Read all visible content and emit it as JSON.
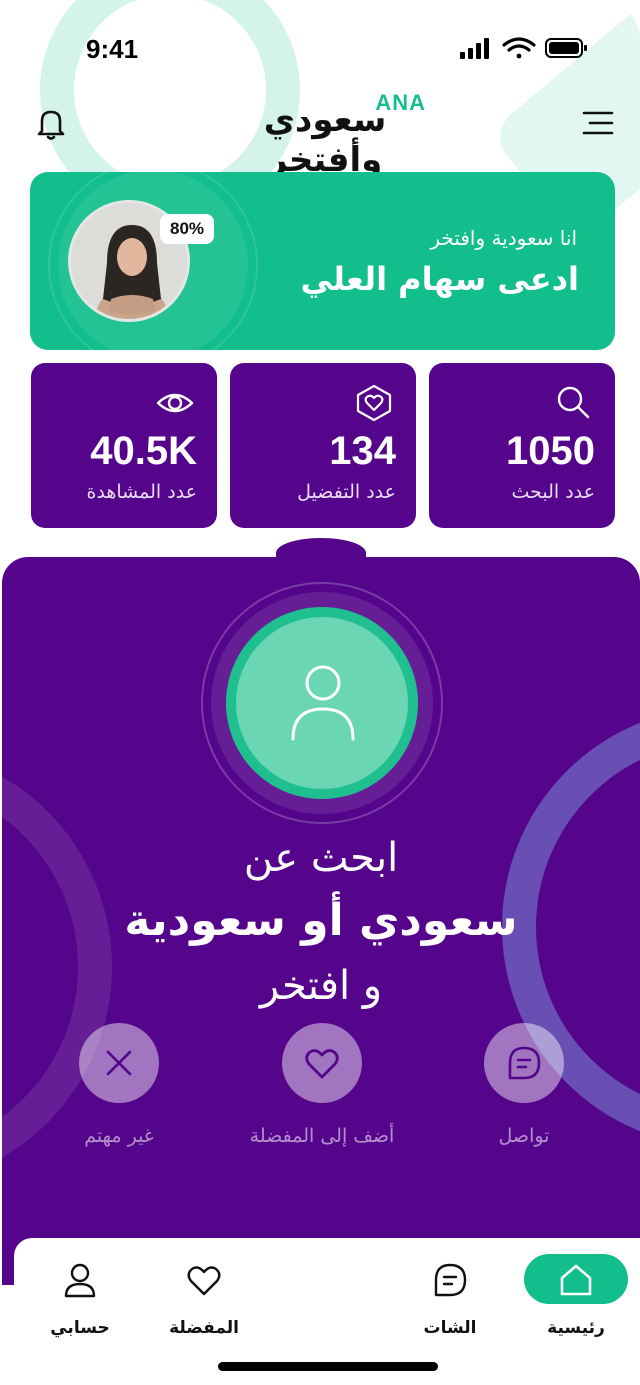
{
  "status_bar": {
    "time": "9:41"
  },
  "header": {
    "logo_ana": "ANA",
    "logo_arabic": "سعودي وأفتخر"
  },
  "profile": {
    "completion": "80%",
    "subtitle": "انا سعودية وافتخر",
    "name": "ادعى سهام العلي"
  },
  "stats": [
    {
      "value": "1050",
      "label": "عدد البحث",
      "icon": "search-icon"
    },
    {
      "value": "134",
      "label": "عدد التفضيل",
      "icon": "heart-icon"
    },
    {
      "value": "40.5K",
      "label": "عدد المشاهدة",
      "icon": "eye-icon"
    }
  ],
  "main": {
    "line1": "ابحث عن",
    "line2": "سعودي أو سعودية",
    "line3": "و افتخر",
    "actions": [
      {
        "label": "تواصل",
        "icon": "chat-icon"
      },
      {
        "label": "أضف إلى المفضلة",
        "icon": "heart-icon"
      },
      {
        "label": "غير مهتم",
        "icon": "close-icon"
      }
    ]
  },
  "nav": [
    {
      "label": "رئيسية",
      "icon": "home-icon"
    },
    {
      "label": "الشات",
      "icon": "chat-icon"
    },
    {
      "label": "المفضلة",
      "icon": "heart-icon"
    },
    {
      "label": "حسابي",
      "icon": "user-icon"
    }
  ],
  "colors": {
    "green": "#12be8b",
    "purple": "#54058b"
  }
}
